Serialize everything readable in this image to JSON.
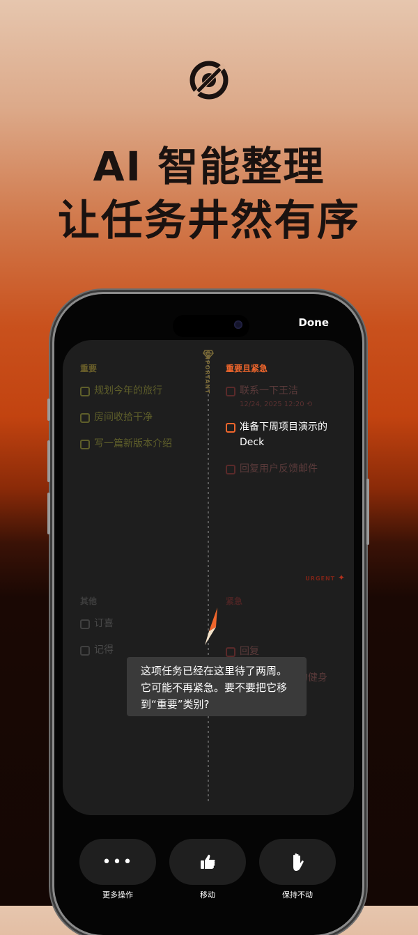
{
  "promo": {
    "headline_line1": "AI 智能整理",
    "headline_line2": "让任务井然有序"
  },
  "phone": {
    "done_label": "Done",
    "axis_important": "IMPORTANT",
    "axis_urgent": "URGENT"
  },
  "quadrants": {
    "important": {
      "title": "重要",
      "tasks": [
        "规划今年的旅行",
        "房间收拾干净",
        "写一篇新版本介绍"
      ]
    },
    "important_urgent": {
      "title": "重要且紧急",
      "tasks": [
        {
          "label": "联系一下王洁",
          "meta": "12/24, 2025 12:20"
        },
        {
          "label_line1": "准备下周项目演示的",
          "label_line2": "Deck"
        },
        {
          "label": "回复用户反馈邮件"
        }
      ]
    },
    "neither": {
      "title": "其他",
      "tasks": [
        "订喜",
        "记得"
      ]
    },
    "urgent": {
      "title": "紧急",
      "tasks": [
        {
          "label": "回复"
        },
        {
          "label_line1": "定制下个季度的健身",
          "label_line2": "计划"
        }
      ]
    }
  },
  "tooltip": {
    "line1": "这项任务已经在这里待了两周。",
    "line2": "它可能不再紧急。要不要把它移",
    "line3": "到“重要”类别?"
  },
  "actions": [
    {
      "label": "更多操作",
      "icon": "more-dots-icon"
    },
    {
      "label": "移动",
      "icon": "thumbs-up-icon"
    },
    {
      "label": "保持不动",
      "icon": "raised-hand-icon"
    }
  ],
  "colors": {
    "accent_orange": "#f0662c",
    "important_yellow": "#6e6a28",
    "urgent_red": "#5a2222"
  }
}
